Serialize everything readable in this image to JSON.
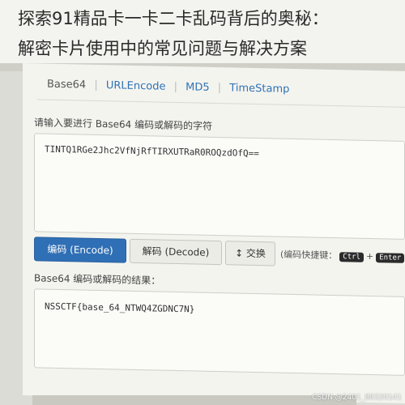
{
  "headline": {
    "line1": "探索91精品卡一卡二卡乱码背后的奥秘：",
    "line2": "解密卡片使用中的常见问题与解决方案"
  },
  "tabs": [
    "Base64",
    "URLEncode",
    "MD5",
    "TimeStamp"
  ],
  "input": {
    "label": "请输入要进行 Base64 编码或解码的字符",
    "value": "TINTQ1RGe2Jhc2VfNjRfTIRXUTRaR0ROQzdOfQ=="
  },
  "buttons": {
    "encode": "编码 (Encode)",
    "decode": "解码 (Decode)",
    "swap": "↕ 交换"
  },
  "shortcut": {
    "label": "(编码快捷键：",
    "key1": "Ctrl",
    "sep": "+",
    "key2": "Enter"
  },
  "output": {
    "label": "Base64 编码或解码的结果：",
    "value": "NSSCTF{base_64_NTWQ4ZGDNC7N}"
  },
  "watermark": "CSDN @2401_88320141"
}
